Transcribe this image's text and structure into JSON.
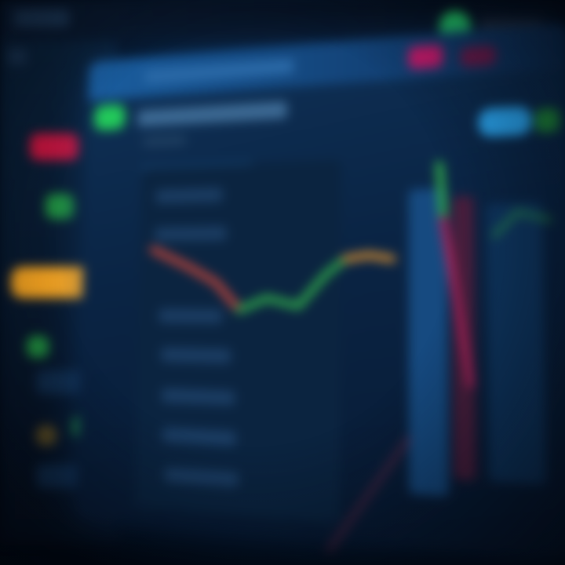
{
  "accents": {
    "green": "#22c95a",
    "red": "#c0143c",
    "orange": "#f0a020",
    "blue": "#2aa4ee",
    "magenta": "#c21a6a",
    "line_red": "#c2453a",
    "line_green": "#2fa84a",
    "line_orange": "#d08a30"
  },
  "icons": {
    "status": "status-dot-icon",
    "alert": "alert-dot-icon"
  },
  "visible_text_note": ""
}
